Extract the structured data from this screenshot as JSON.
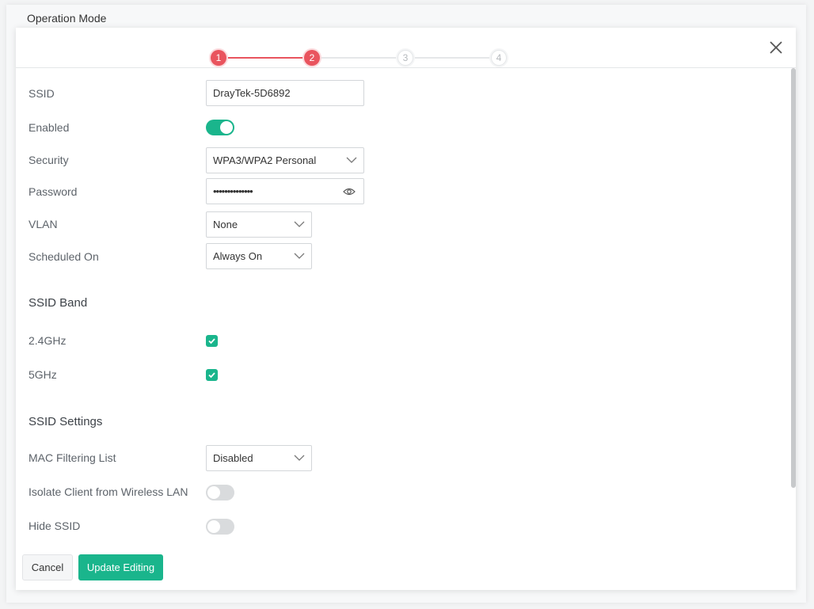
{
  "background": {
    "title": "Operation Mode"
  },
  "stepper": {
    "steps": [
      {
        "label": "1",
        "state": "active"
      },
      {
        "label": "2",
        "state": "active"
      },
      {
        "label": "3",
        "state": "inactive"
      },
      {
        "label": "4",
        "state": "inactive"
      }
    ],
    "colors": {
      "active": "#e9545e",
      "inactive": "#e5e7e9"
    }
  },
  "form": {
    "ssid": {
      "label": "SSID",
      "value": "DrayTek-5D6892"
    },
    "enabled": {
      "label": "Enabled",
      "on": true
    },
    "security": {
      "label": "Security",
      "value": "WPA3/WPA2 Personal"
    },
    "password": {
      "label": "Password",
      "value": "••••••••••••••"
    },
    "vlan": {
      "label": "VLAN",
      "value": "None"
    },
    "scheduled": {
      "label": "Scheduled On",
      "value": "Always On"
    }
  },
  "ssid_band": {
    "title": "SSID Band",
    "band_24": {
      "label": "2.4GHz",
      "checked": true
    },
    "band_5": {
      "label": "5GHz",
      "checked": true
    }
  },
  "ssid_settings": {
    "title": "SSID Settings",
    "mac_filter": {
      "label": "MAC Filtering List",
      "value": "Disabled"
    },
    "isolate": {
      "label": "Isolate Client from Wireless LAN",
      "on": false
    },
    "hide": {
      "label": "Hide SSID",
      "on": false
    }
  },
  "footer": {
    "cancel_label": "Cancel",
    "update_label": "Update Editing"
  },
  "colors": {
    "accent": "#1ab58c",
    "step_active": "#e9545e"
  },
  "icons": {
    "close": "close-icon",
    "arrow": "chevron-down-icon",
    "eye": "eye-icon",
    "check": "check-icon"
  }
}
